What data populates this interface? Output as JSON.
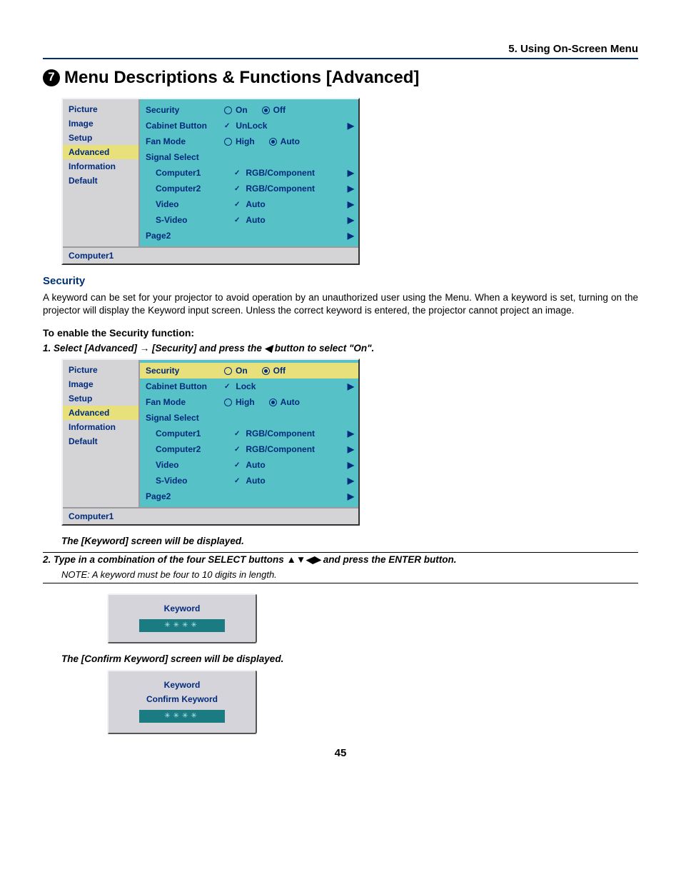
{
  "chapter_header": "5. Using On-Screen Menu",
  "section_number": "7",
  "section_title": "Menu Descriptions & Functions [Advanced]",
  "left_menu": {
    "items": [
      "Picture",
      "Image",
      "Setup",
      "Advanced",
      "Information",
      "Default"
    ],
    "selected_index": 3
  },
  "osd1": {
    "highlight_row_index": -1,
    "rows": [
      {
        "label": "Security",
        "type": "radio",
        "opts": [
          "On",
          "Off"
        ],
        "sel": 1,
        "arrow": false,
        "indent": false
      },
      {
        "label": "Cabinet Button",
        "type": "check",
        "value": "UnLock",
        "arrow": true,
        "indent": false
      },
      {
        "label": "Fan Mode",
        "type": "radio",
        "opts": [
          "High",
          "Auto"
        ],
        "sel": 1,
        "arrow": false,
        "indent": false
      },
      {
        "label": "Signal Select",
        "type": "header",
        "arrow": false,
        "indent": false
      },
      {
        "label": "Computer1",
        "type": "check",
        "value": "RGB/Component",
        "arrow": true,
        "indent": true
      },
      {
        "label": "Computer2",
        "type": "check",
        "value": "RGB/Component",
        "arrow": true,
        "indent": true
      },
      {
        "label": "Video",
        "type": "check",
        "value": "Auto",
        "arrow": true,
        "indent": true
      },
      {
        "label": "S-Video",
        "type": "check",
        "value": "Auto",
        "arrow": true,
        "indent": true
      },
      {
        "label": "Page2",
        "type": "plain",
        "arrow": true,
        "indent": false
      }
    ],
    "status": "Computer1"
  },
  "security_heading": "Security",
  "security_body": "A keyword can be set for your projector to avoid operation by an unauthorized user using the Menu. When a keyword is set, turning on the projector will display the Keyword input screen. Unless the correct keyword is entered, the projector cannot project an image.",
  "enable_heading": "To enable the Security function:",
  "step1_pre": "1. Select [Advanced] → [Security] and press the ",
  "step1_post": " button to select \"On\".",
  "step1_arrow": "◀",
  "osd2": {
    "highlight_row_index": 0,
    "rows": [
      {
        "label": "Security",
        "type": "radio",
        "opts": [
          "On",
          "Off"
        ],
        "sel": 1,
        "arrow": false,
        "indent": false
      },
      {
        "label": "Cabinet Button",
        "type": "check",
        "value": "Lock",
        "arrow": true,
        "indent": false
      },
      {
        "label": "Fan Mode",
        "type": "radio",
        "opts": [
          "High",
          "Auto"
        ],
        "sel": 1,
        "arrow": false,
        "indent": false
      },
      {
        "label": "Signal Select",
        "type": "header",
        "arrow": false,
        "indent": false
      },
      {
        "label": "Computer1",
        "type": "check",
        "value": "RGB/Component",
        "arrow": true,
        "indent": true
      },
      {
        "label": "Computer2",
        "type": "check",
        "value": "RGB/Component",
        "arrow": true,
        "indent": true
      },
      {
        "label": "Video",
        "type": "check",
        "value": "Auto",
        "arrow": true,
        "indent": true
      },
      {
        "label": "S-Video",
        "type": "check",
        "value": "Auto",
        "arrow": true,
        "indent": true
      },
      {
        "label": "Page2",
        "type": "plain",
        "arrow": true,
        "indent": false
      }
    ],
    "status": "Computer1"
  },
  "result1": "The [Keyword] screen will be displayed.",
  "step2_pre": "2. Type in a combination of the four SELECT buttons ",
  "step2_arrows": "▲▼◀▶",
  "step2_post": " and press the ENTER button.",
  "note": "NOTE: A keyword must be four to 10 digits in length.",
  "kw1": {
    "title": "Keyword",
    "value": "✳✳✳✳"
  },
  "result2": "The [Confirm Keyword] screen will be displayed.",
  "kw2": {
    "title1": "Keyword",
    "title2": "Confirm Keyword",
    "value": "✳✳✳✳"
  },
  "page_number": "45"
}
